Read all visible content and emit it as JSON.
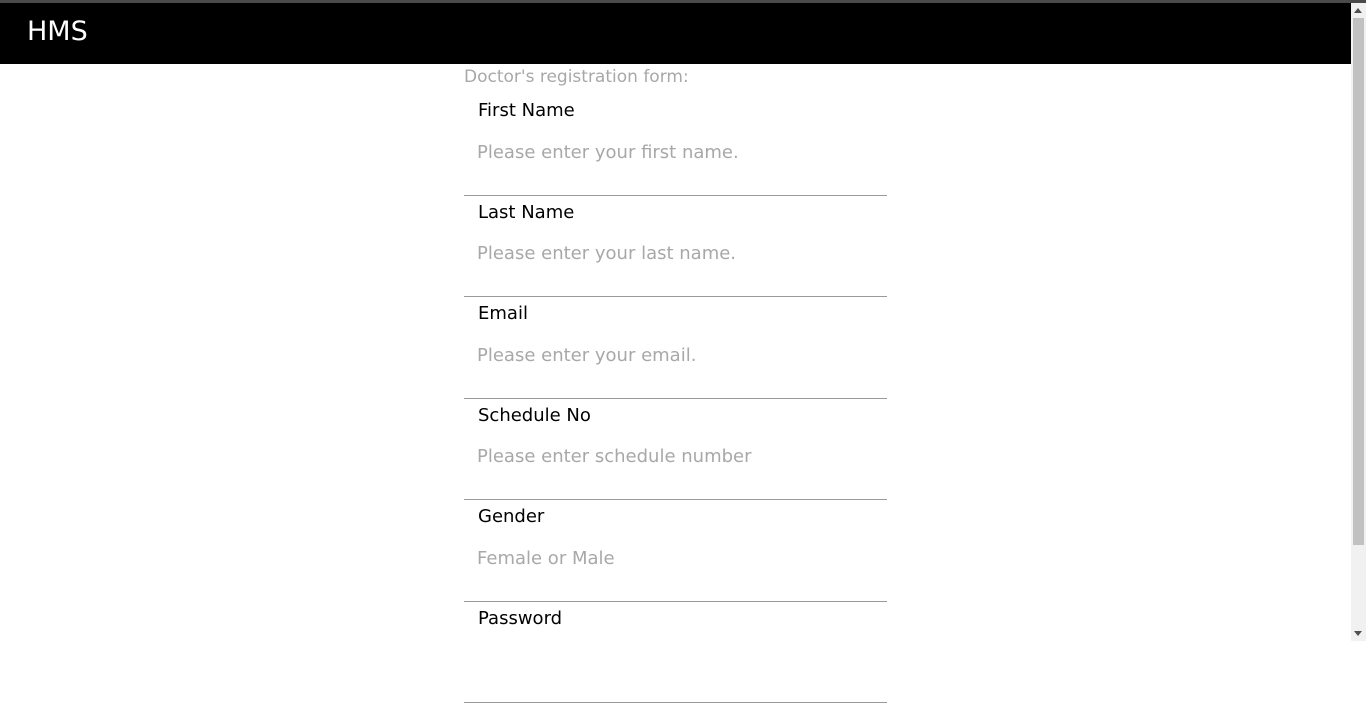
{
  "app": {
    "brand": "HMS"
  },
  "form": {
    "title": "Doctor's registration form:",
    "fields": [
      {
        "label": "First Name",
        "placeholder": "Please enter your first name.",
        "value": ""
      },
      {
        "label": "Last Name",
        "placeholder": "Please enter your last name.",
        "value": ""
      },
      {
        "label": "Email",
        "placeholder": "Please enter your email.",
        "value": ""
      },
      {
        "label": "Schedule No",
        "placeholder": "Please enter schedule number",
        "value": ""
      },
      {
        "label": "Gender",
        "placeholder": "Female or Male",
        "value": ""
      },
      {
        "label": "Password",
        "placeholder": "",
        "value": ""
      }
    ]
  },
  "colors": {
    "navbar_bg": "#000000",
    "brand_text": "#ffffff",
    "placeholder_text": "#a8a8a8",
    "divider": "#9a9a9a"
  },
  "icons": {
    "scroll_up": "triangle-up-icon",
    "scroll_down": "triangle-down-icon"
  }
}
